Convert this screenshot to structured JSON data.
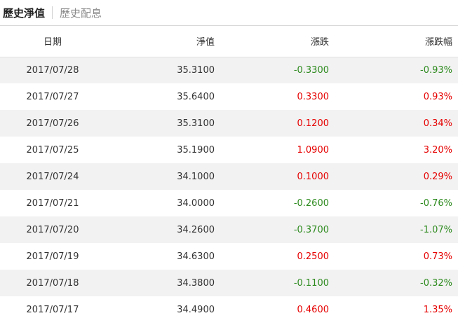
{
  "tabs": [
    {
      "label": "歷史淨值",
      "active": true
    },
    {
      "label": "歷史配息",
      "active": false
    }
  ],
  "table": {
    "headers": [
      "日期",
      "淨值",
      "漲跌",
      "漲跌幅"
    ],
    "rows": [
      {
        "date": "2017/07/28",
        "nav": "35.3100",
        "change": "-0.3300",
        "pct": "-0.93%"
      },
      {
        "date": "2017/07/27",
        "nav": "35.6400",
        "change": "0.3300",
        "pct": "0.93%"
      },
      {
        "date": "2017/07/26",
        "nav": "35.3100",
        "change": "0.1200",
        "pct": "0.34%"
      },
      {
        "date": "2017/07/25",
        "nav": "35.1900",
        "change": "1.0900",
        "pct": "3.20%"
      },
      {
        "date": "2017/07/24",
        "nav": "34.1000",
        "change": "0.1000",
        "pct": "0.29%"
      },
      {
        "date": "2017/07/21",
        "nav": "34.0000",
        "change": "-0.2600",
        "pct": "-0.76%"
      },
      {
        "date": "2017/07/20",
        "nav": "34.2600",
        "change": "-0.3700",
        "pct": "-1.07%"
      },
      {
        "date": "2017/07/19",
        "nav": "34.6300",
        "change": "0.2500",
        "pct": "0.73%"
      },
      {
        "date": "2017/07/18",
        "nav": "34.3800",
        "change": "-0.1100",
        "pct": "-0.32%"
      },
      {
        "date": "2017/07/17",
        "nav": "34.4900",
        "change": "0.4600",
        "pct": "1.35%"
      }
    ]
  },
  "colors": {
    "up": "#e60000",
    "down": "#2e8b1f",
    "stripe": "#f2f2f2"
  }
}
